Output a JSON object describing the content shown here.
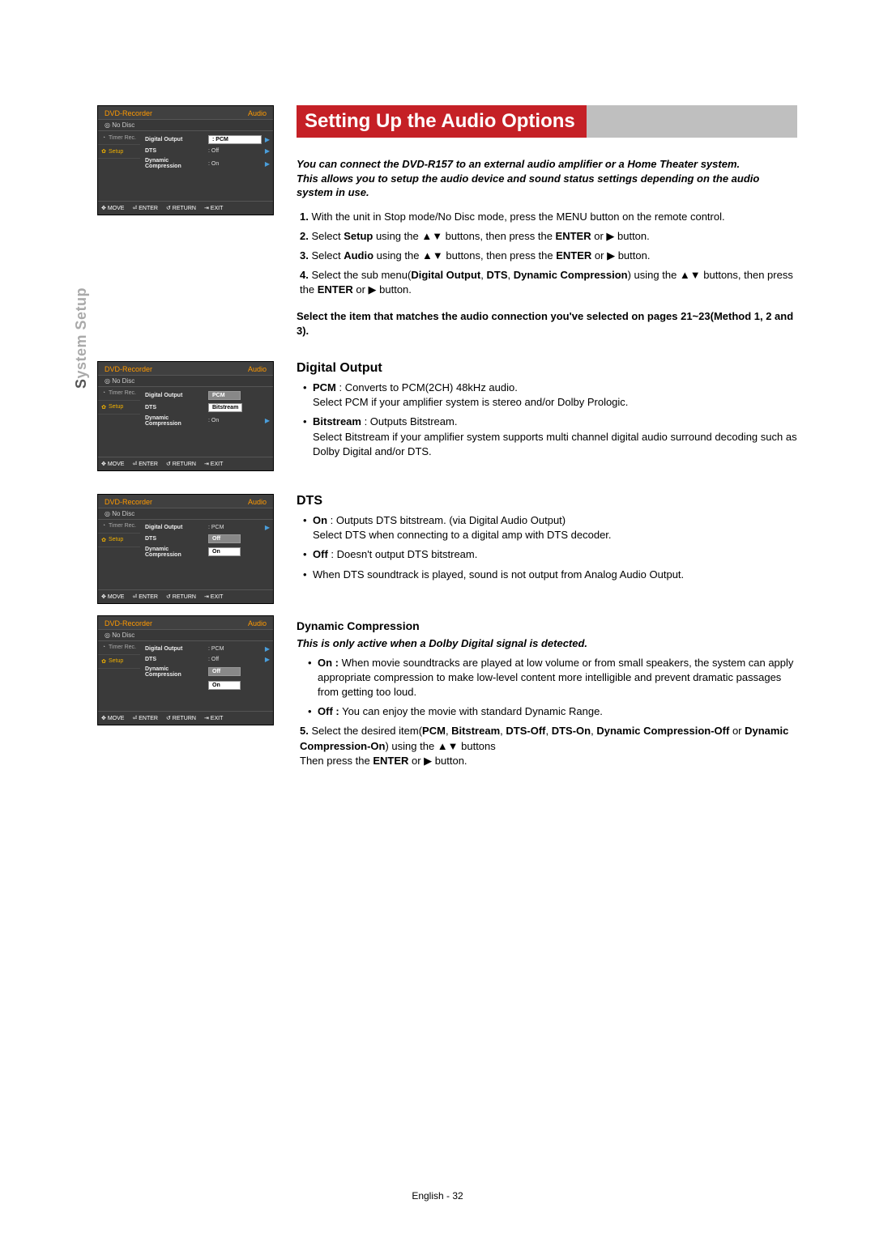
{
  "page": {
    "sidebar_bold": "S",
    "sidebar_rest": "ystem Setup",
    "title": "Setting Up the Audio Options",
    "footer": "English - 32"
  },
  "intro": {
    "line1": "You can connect the DVD-R157 to an external audio amplifier or a Home Theater system.",
    "line2": "This allows you to setup the audio device and sound status settings depending on the audio system in use."
  },
  "steps": {
    "s1": "With the unit in Stop mode/No Disc mode, press the MENU button on the remote control.",
    "s2a": "Select ",
    "s2b": "Setup",
    "s2c": " using the ▲▼ buttons, then press the ",
    "s2d": "ENTER",
    "s2e": " or ▶ button.",
    "s3a": "Select ",
    "s3b": "Audio",
    "s3c": " using the ▲▼ buttons, then press the ",
    "s3d": "ENTER",
    "s3e": " or ▶ button.",
    "s4a": "Select the sub menu(",
    "s4b": "Digital Output",
    "s4c": ", ",
    "s4d": "DTS",
    "s4e": ", ",
    "s4f": "Dynamic Compression",
    "s4g": ") using the ▲▼ buttons, then press the ",
    "s4h": "ENTER",
    "s4i": " or ▶ button."
  },
  "select_item": "Select the item that matches the audio connection you've selected on pages 21~23(Method 1, 2 and 3).",
  "digital_output": {
    "heading": "Digital Output",
    "pcm_label": "PCM",
    "pcm_desc": " : Converts to PCM(2CH) 48kHz audio.",
    "pcm_desc2": "Select PCM if your amplifier system is stereo and/or Dolby Prologic.",
    "bit_label": "Bitstream",
    "bit_desc": " : Outputs Bitstream.",
    "bit_desc2": "Select Bitstream if your amplifier system supports multi channel digital audio surround decoding such as Dolby Digital and/or DTS."
  },
  "dts": {
    "heading": "DTS",
    "on_label": "On",
    "on_desc": " : Outputs DTS bitstream. (via Digital Audio Output)",
    "on_desc2": "Select DTS when connecting to a digital amp with DTS decoder.",
    "off_label": "Off",
    "off_desc": " : Doesn't output DTS bitstream.",
    "note": "When DTS soundtrack is played, sound is not output from Analog Audio Output."
  },
  "dyn": {
    "heading": "Dynamic Compression",
    "italic": "This is only active when a Dolby Digital signal is detected.",
    "on_label": "On :",
    "on_desc": " When movie soundtracks are played at low volume or from small speakers, the system can apply appropriate compression to make low-level content more intelligible and prevent dramatic passages from getting too loud.",
    "off_label": "Off :",
    "off_desc": " You can enjoy the movie with standard Dynamic Range.",
    "s5a": "Select the desired item(",
    "s5b": "PCM",
    "s5c": ", ",
    "s5d": "Bitstream",
    "s5e": ", ",
    "s5f": "DTS-Off",
    "s5g": ", ",
    "s5h": "DTS-On",
    "s5i": ", ",
    "s5j": "Dynamic Compression-Off",
    "s5k": " or ",
    "s5l": "Dynamic Compression-On",
    "s5m": ") using the ▲▼ buttons",
    "s5n": "Then press the ",
    "s5o": "ENTER",
    "s5p": " or ▶ button."
  },
  "osd_common": {
    "brand": "DVD-Recorder",
    "audio": "Audio",
    "nodisc": "No Disc",
    "timer": "Timer Rec.",
    "setup": "Setup",
    "move": "MOVE",
    "enter": "ENTER",
    "return": "RETURN",
    "exit": "EXIT",
    "opt_digital": "Digital Output",
    "opt_dts": "DTS",
    "opt_dyn": "Dynamic Compression"
  },
  "osd1": {
    "digital": ": PCM",
    "dts": ": Off",
    "dyn": ": On"
  },
  "osd2": {
    "digital_box1": "PCM",
    "digital_box2": "Bitstream",
    "dyn": ": On"
  },
  "osd3": {
    "digital": ": PCM",
    "dts_box1": "Off",
    "dts_box2": "On"
  },
  "osd4": {
    "digital": ": PCM",
    "dts": ": Off",
    "dyn_box1": "Off",
    "dyn_box2": "On"
  }
}
